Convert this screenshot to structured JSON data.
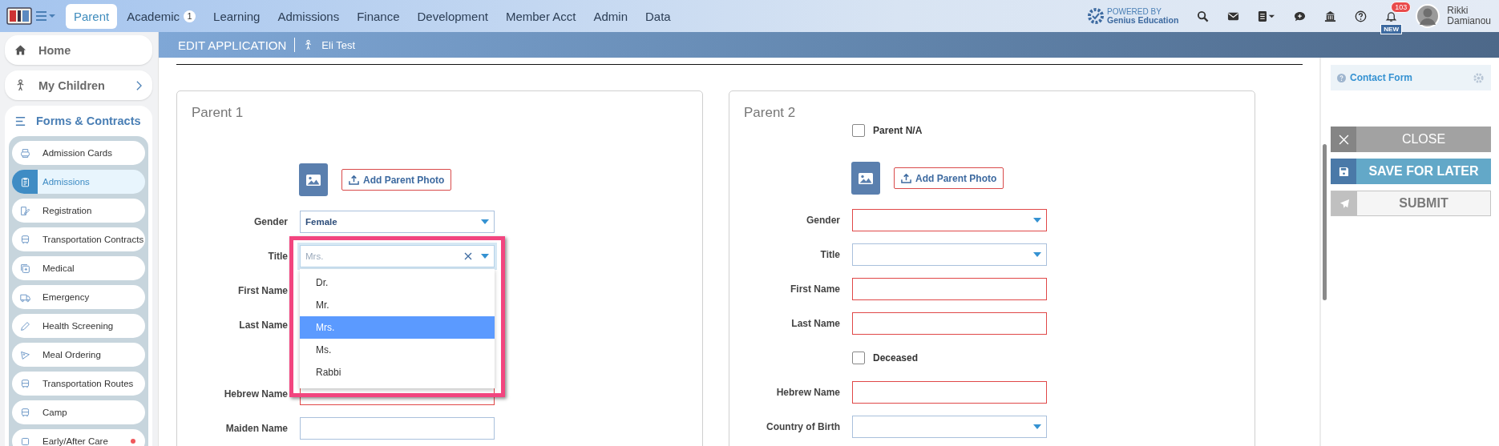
{
  "topbar": {
    "tabs": [
      {
        "label": "Parent",
        "selected": true
      },
      {
        "label": "Academic",
        "selected": false,
        "badge": "1"
      },
      {
        "label": "Learning",
        "selected": false
      },
      {
        "label": "Admissions",
        "selected": false
      },
      {
        "label": "Finance",
        "selected": false
      },
      {
        "label": "Development",
        "selected": false
      },
      {
        "label": "Member Acct",
        "selected": false
      },
      {
        "label": "Admin",
        "selected": false
      },
      {
        "label": "Data",
        "selected": false
      }
    ],
    "powered_by": {
      "line1": "POWERED BY",
      "line2": "Genius Education"
    },
    "notifications": {
      "count": "103",
      "tag": "NEW"
    },
    "user": {
      "first_name": "Rikki",
      "last_name": "Damianou"
    }
  },
  "header": {
    "title": "EDIT APPLICATION",
    "student": "Eli Test"
  },
  "sidebar": {
    "home": "Home",
    "my_children": "My Children",
    "forms": {
      "label": "Forms & Contracts",
      "expanded": true,
      "items": [
        {
          "label": "Admission Cards",
          "selected": false,
          "alert": false
        },
        {
          "label": "Admissions",
          "selected": true,
          "alert": false
        },
        {
          "label": "Registration",
          "selected": false,
          "alert": false
        },
        {
          "label": "Transportation Contracts",
          "selected": false,
          "alert": false
        },
        {
          "label": "Medical",
          "selected": false,
          "alert": false
        },
        {
          "label": "Emergency",
          "selected": false,
          "alert": false
        },
        {
          "label": "Health Screening",
          "selected": false,
          "alert": false
        },
        {
          "label": "Meal Ordering",
          "selected": false,
          "alert": false
        },
        {
          "label": "Transportation Routes",
          "selected": false,
          "alert": false
        },
        {
          "label": "Camp",
          "selected": false,
          "alert": false
        },
        {
          "label": "Early/After Care",
          "selected": false,
          "alert": true
        }
      ]
    }
  },
  "parents": [
    {
      "title": "Parent 1",
      "photo_button": "Add Parent Photo",
      "fields": [
        {
          "kind": "select",
          "label": "Gender",
          "value": "Female",
          "invalid": false
        },
        {
          "kind": "open-select",
          "label": "Title",
          "placeholder": "Mrs.",
          "options": [
            {
              "label": "Dr.",
              "selected": false
            },
            {
              "label": "Mr.",
              "selected": false
            },
            {
              "label": "Mrs.",
              "selected": true
            },
            {
              "label": "Ms.",
              "selected": false
            },
            {
              "label": "Rabbi",
              "selected": false
            }
          ]
        },
        {
          "kind": "label",
          "label": "First Name"
        },
        {
          "kind": "label",
          "label": "Last Name"
        },
        {
          "kind": "covered"
        },
        {
          "kind": "text",
          "label": "Hebrew Name",
          "invalid": true
        },
        {
          "kind": "text",
          "label": "Maiden Name",
          "invalid": false
        }
      ]
    },
    {
      "title": "Parent 2",
      "na_checkbox": {
        "label": "Parent N/A",
        "checked": false
      },
      "photo_button": "Add Parent Photo",
      "fields": [
        {
          "kind": "select",
          "label": "Gender",
          "invalid": true
        },
        {
          "kind": "select",
          "label": "Title",
          "invalid": false
        },
        {
          "kind": "text",
          "label": "First Name",
          "invalid": true
        },
        {
          "kind": "text",
          "label": "Last Name",
          "invalid": true
        },
        {
          "kind": "checkbox",
          "label": "Deceased",
          "checked": false
        },
        {
          "kind": "text",
          "label": "Hebrew Name",
          "invalid": true
        },
        {
          "kind": "select",
          "label": "Country of Birth",
          "invalid": false
        }
      ]
    }
  ],
  "side_panel": {
    "contact_form": "Contact Form",
    "buttons": [
      {
        "kind": "close",
        "label": "CLOSE"
      },
      {
        "kind": "save",
        "label": "SAVE FOR LATER"
      },
      {
        "kind": "submit",
        "label": "SUBMIT"
      }
    ]
  }
}
